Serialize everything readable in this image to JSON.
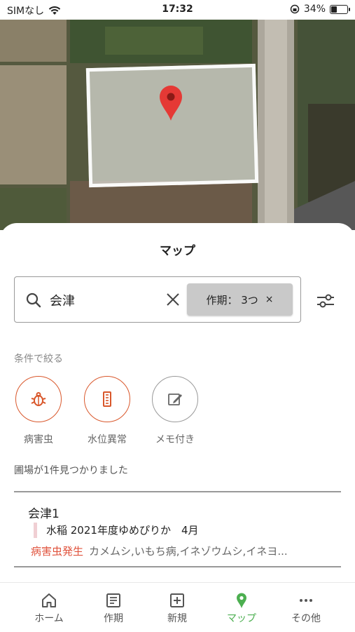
{
  "status": {
    "carrier": "SIMなし",
    "time": "17:32",
    "battery": "34%",
    "battery_level": 0.34
  },
  "sheet": {
    "title": "マップ"
  },
  "search": {
    "value": "会津"
  },
  "chip": {
    "label": "作期： 3つ",
    "close": "×"
  },
  "filter_section": {
    "label": "条件で絞る"
  },
  "filters": [
    {
      "label": "病害虫",
      "icon": "bug-icon",
      "color": "#d9572b"
    },
    {
      "label": "水位異常",
      "icon": "water-level-icon",
      "color": "#d9572b"
    },
    {
      "label": "メモ付き",
      "icon": "edit-icon",
      "color": "#666666"
    }
  ],
  "results": {
    "count_text": "圃場が1件見つかりました"
  },
  "field": {
    "name": "会津1",
    "crop": "水稲 2021年度ゆめぴりか　4月",
    "pest_tag": "病害虫発生",
    "pest_names": "カメムシ,いもち病,イネゾウムシ,イネヨ..."
  },
  "tabs": [
    {
      "label": "ホーム",
      "icon": "home-icon"
    },
    {
      "label": "作期",
      "icon": "document-icon"
    },
    {
      "label": "新規",
      "icon": "add-box-icon"
    },
    {
      "label": "マップ",
      "icon": "map-pin-icon",
      "active": true
    },
    {
      "label": "その他",
      "icon": "more-icon"
    }
  ],
  "colors": {
    "accent": "#4caf50",
    "alert": "#e0533d",
    "pin": "#e53935"
  }
}
